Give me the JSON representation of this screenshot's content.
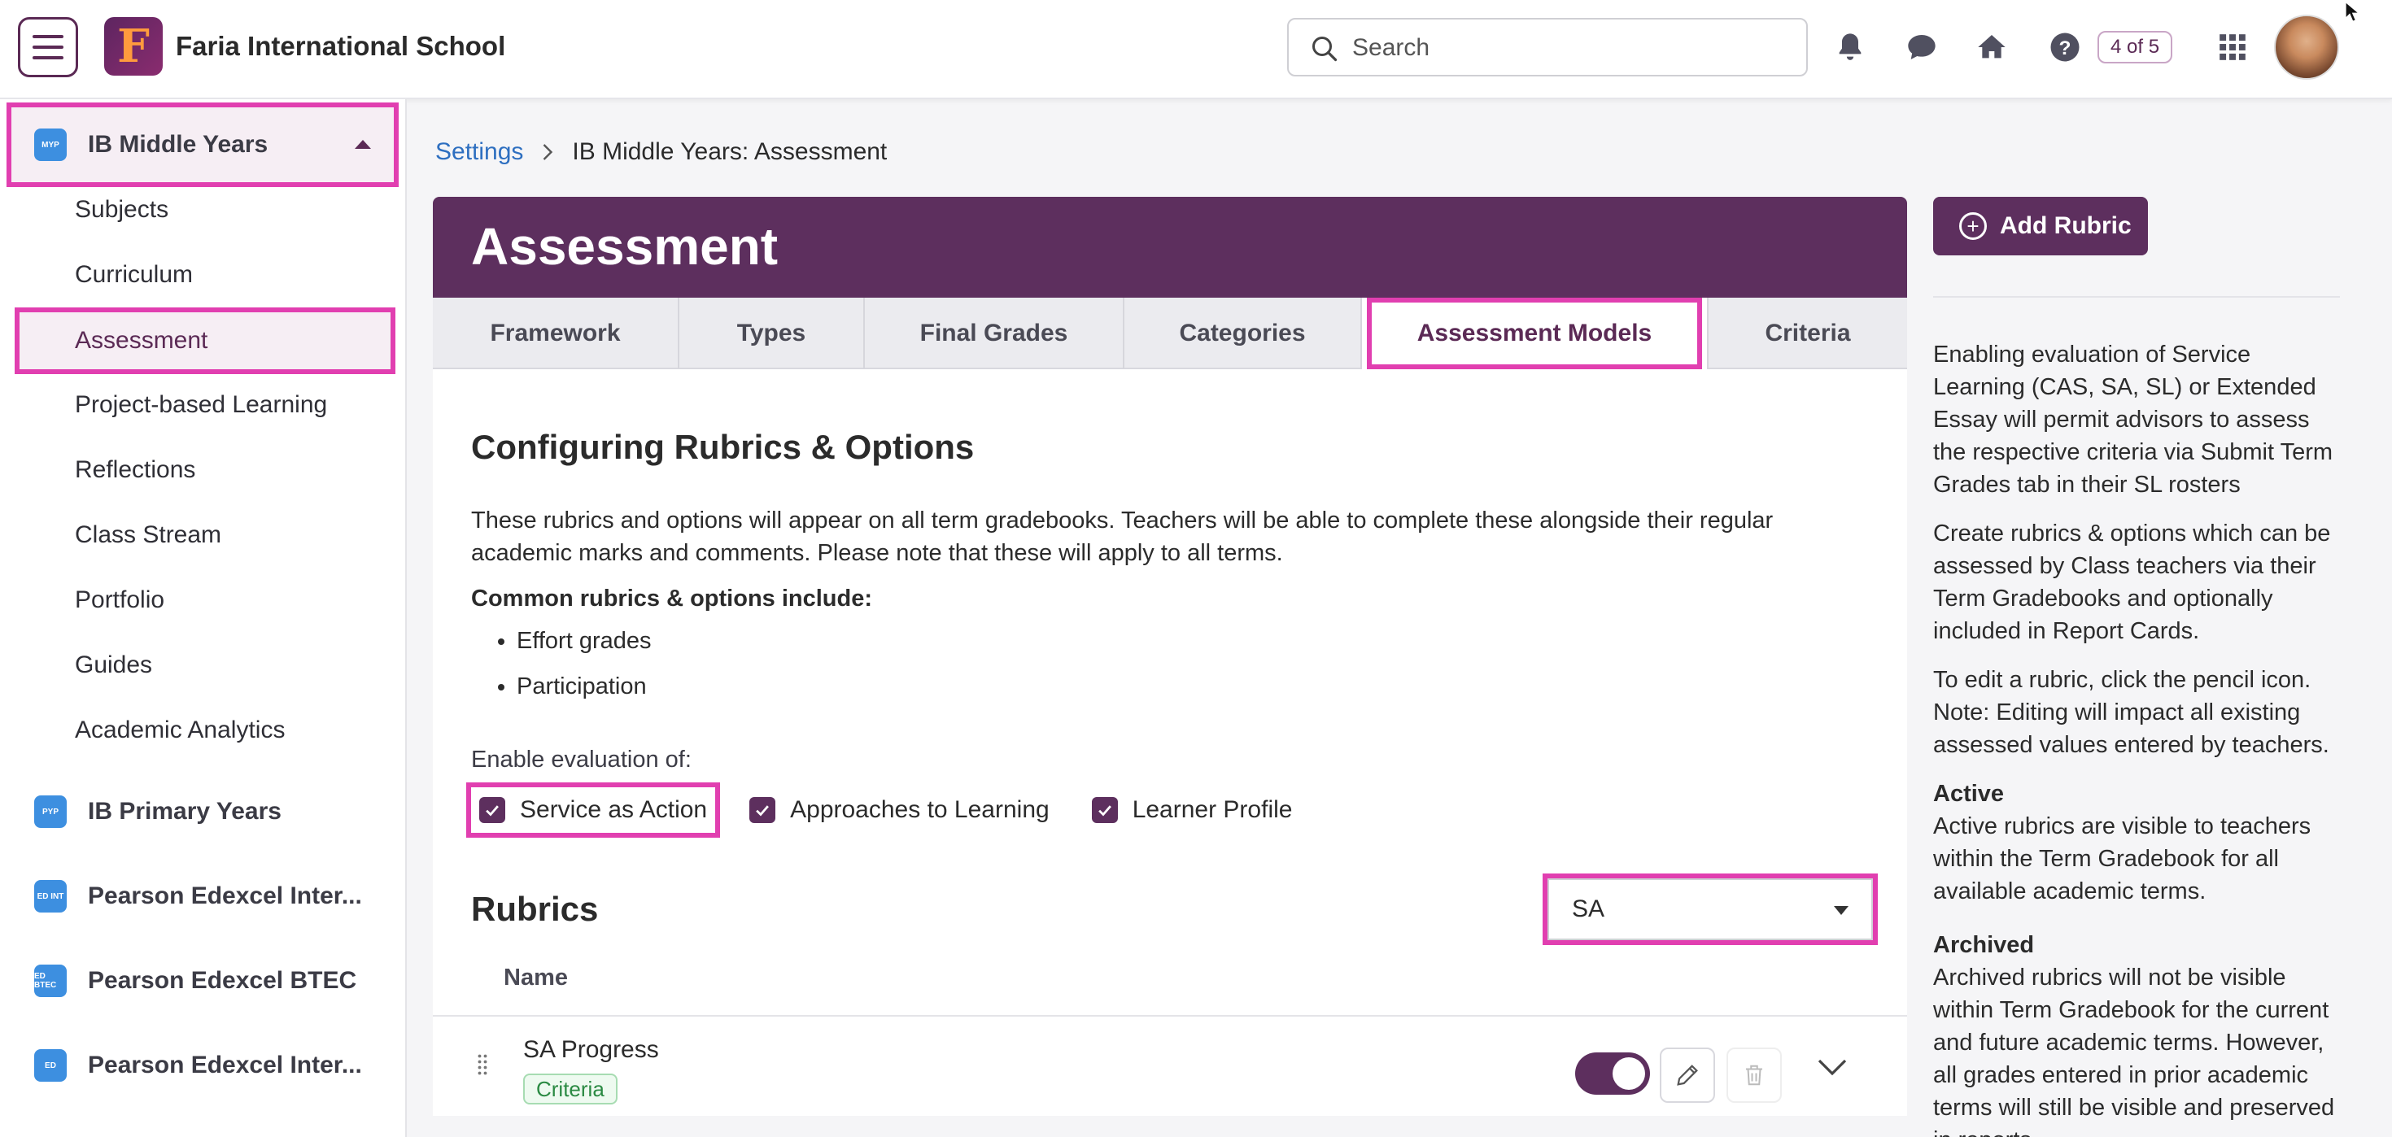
{
  "header": {
    "logo_letter": "F",
    "school_name": "Faria International School",
    "search_placeholder": "Search",
    "tour_badge": "4 of 5"
  },
  "sidebar": {
    "programs": [
      {
        "label": "IB Middle Years",
        "icon_text": "MYP"
      },
      {
        "label": "IB Primary Years",
        "icon_text": "PYP"
      },
      {
        "label": "Pearson Edexcel Inter...",
        "icon_text": "ED INT"
      },
      {
        "label": "Pearson Edexcel BTEC",
        "icon_text": "ED BTEC"
      },
      {
        "label": "Pearson Edexcel Inter...",
        "icon_text": "ED"
      }
    ],
    "items": [
      {
        "label": "Subjects"
      },
      {
        "label": "Curriculum"
      },
      {
        "label": "Assessment"
      },
      {
        "label": "Project-based Learning"
      },
      {
        "label": "Reflections"
      },
      {
        "label": "Class Stream"
      },
      {
        "label": "Portfolio"
      },
      {
        "label": "Guides"
      },
      {
        "label": "Academic Analytics"
      }
    ]
  },
  "breadcrumb": {
    "link": "Settings",
    "current": "IB Middle Years: Assessment"
  },
  "page": {
    "title": "Assessment",
    "tabs": [
      {
        "label": "Framework"
      },
      {
        "label": "Types"
      },
      {
        "label": "Final Grades"
      },
      {
        "label": "Categories"
      },
      {
        "label": "Assessment Models"
      },
      {
        "label": "Criteria"
      }
    ],
    "section_title": "Configuring Rubrics & Options",
    "description": "These rubrics and options will appear on all term gradebooks. Teachers will be able to complete these alongside their regular academic marks and comments. Please note that these will apply to all terms.",
    "common_heading": "Common rubrics & options include:",
    "common_items": [
      "Effort grades",
      "Participation"
    ],
    "enable_label": "Enable evaluation of:",
    "checkboxes": [
      {
        "label": "Service as Action",
        "checked": true
      },
      {
        "label": "Approaches to Learning",
        "checked": true
      },
      {
        "label": "Learner Profile",
        "checked": true
      }
    ],
    "rubrics_title": "Rubrics",
    "rubric_filter": "SA",
    "column_name": "Name",
    "rubric_rows": [
      {
        "name": "SA Progress",
        "tag": "Criteria",
        "active": true
      }
    ]
  },
  "right_panel": {
    "add_button": "Add Rubric",
    "para1": "Enabling evaluation of Service Learning (CAS, SA, SL) or Extended Essay will permit advisors to assess the respective criteria via Submit Term Grades tab in their SL rosters",
    "para2": "Create rubrics & options which can be assessed by Class teachers via their Term Gradebooks and optionally included in Report Cards.",
    "para3": "To edit a rubric, click the pencil icon. Note: Editing will impact all existing assessed values entered by teachers.",
    "active_heading": "Active",
    "active_text": "Active rubrics are visible to teachers within the Term Gradebook for all available academic terms.",
    "archived_heading": "Archived",
    "archived_text": "Archived rubrics will not be visible within Term Gradebook for the current and future academic terms. However, all grades entered in prior academic terms will still be visible and preserved in reports."
  },
  "colors": {
    "brand": "#5d2f5e",
    "highlight": "#e13fb0",
    "link": "#2e6fc0"
  }
}
